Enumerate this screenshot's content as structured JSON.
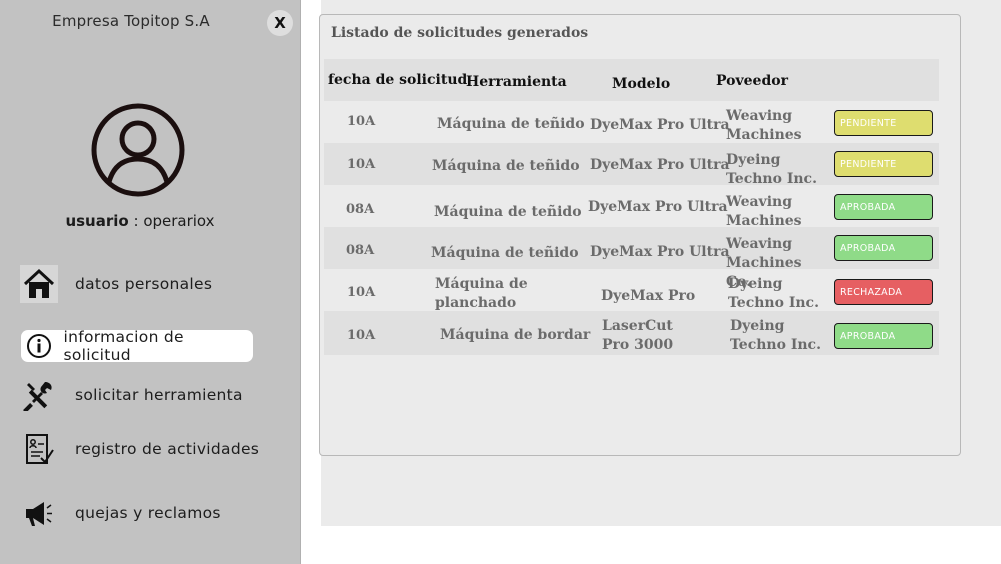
{
  "sidebar": {
    "company": "Empresa Topitop S.A",
    "close_label": "X",
    "user_label": "usuario",
    "user_sep": " : ",
    "username": "operariox",
    "items": [
      {
        "label": "datos personales",
        "icon": "home-icon"
      },
      {
        "label": "informacion de solicitud",
        "icon": "info-icon"
      },
      {
        "label": "solicitar herramienta",
        "icon": "tools-icon"
      },
      {
        "label": "registro de actividades",
        "icon": "clipboard-icon"
      },
      {
        "label": "quejas y reclamos",
        "icon": "megaphone-icon"
      }
    ]
  },
  "panel": {
    "title": "Listado de solicitudes generados",
    "headers": [
      "fecha de solicitud",
      "Herramienta",
      "Modelo",
      "Poveedor"
    ],
    "rows": [
      {
        "date": "10A",
        "tool": "Máquina de teñido",
        "model": "DyeMax Pro Ultra",
        "supplier": "Weaving Machines Co.",
        "status": "PENDIENTE"
      },
      {
        "date": "10A",
        "tool": "Máquina de teñido",
        "model": "DyeMax Pro Ultra",
        "supplier": "Dyeing Techno Inc.",
        "status": "PENDIENTE"
      },
      {
        "date": "08A",
        "tool": "Máquina de teñido",
        "model": "DyeMax Pro Ultra",
        "supplier": "Weaving Machines Co.",
        "status": "APROBADA"
      },
      {
        "date": "08A",
        "tool": "Máquina de teñido",
        "model": "DyeMax Pro Ultra",
        "supplier": "Weaving Machines Co.",
        "status": "APROBADA"
      },
      {
        "date": "10A",
        "tool": "Máquina de planchado",
        "model": "DyeMax Pro",
        "supplier": "Dyeing Techno Inc.",
        "status": "RECHAZADA"
      },
      {
        "date": "10A",
        "tool": "Máquina de bordar",
        "model": "LaserCut Pro 3000",
        "supplier": "Dyeing Techno Inc.",
        "status": "APROBADA"
      }
    ]
  },
  "colors": {
    "pendiente": "#dedd6f",
    "aprobada": "#8fdb88",
    "rechazada": "#e65f62",
    "sidebar": "#c2c2c2"
  }
}
